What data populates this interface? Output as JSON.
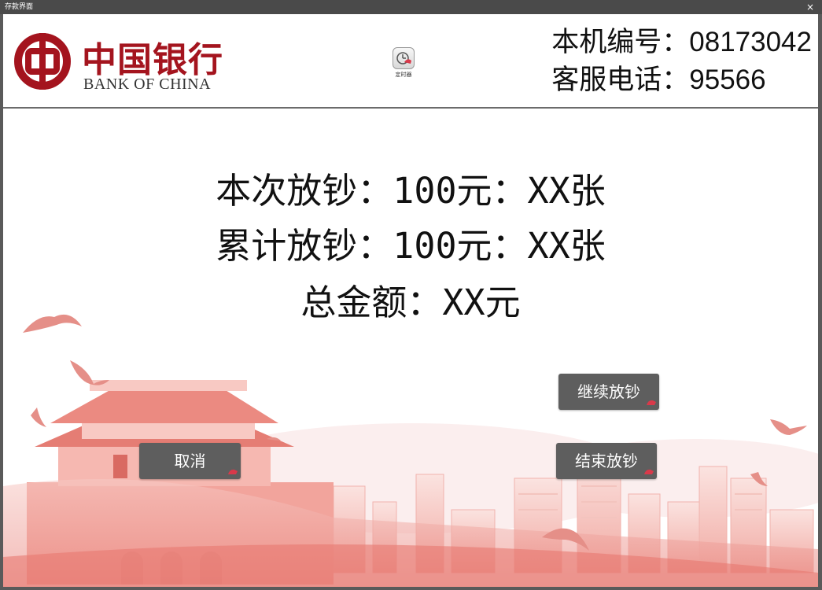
{
  "window": {
    "title": "存款界面",
    "close_glyph": "×"
  },
  "header": {
    "logo": {
      "name_zh": "中国银行",
      "name_en": "BANK OF CHINA",
      "icon": "bank-of-china-logo"
    },
    "timer": {
      "label": "定时器",
      "icon": "timer-icon"
    },
    "device_line": {
      "label": "本机编号：",
      "value": "08173042"
    },
    "service_line": {
      "label": "客服电话：",
      "value": "95566"
    }
  },
  "stats": {
    "current": {
      "label": "本次放钞：",
      "amount": "100元：XX张"
    },
    "cumulative": {
      "label": "累计放钞：",
      "amount": "100元：XX张"
    },
    "total": {
      "label": "总金额：",
      "amount": "XX元"
    }
  },
  "buttons": {
    "continue": "继续放钞",
    "end": "结束放钞",
    "cancel": "取消"
  },
  "colors": {
    "brand_red": "#a4141e",
    "button_gray": "#5e5e5e",
    "titlebar": "#4a4a4a"
  }
}
